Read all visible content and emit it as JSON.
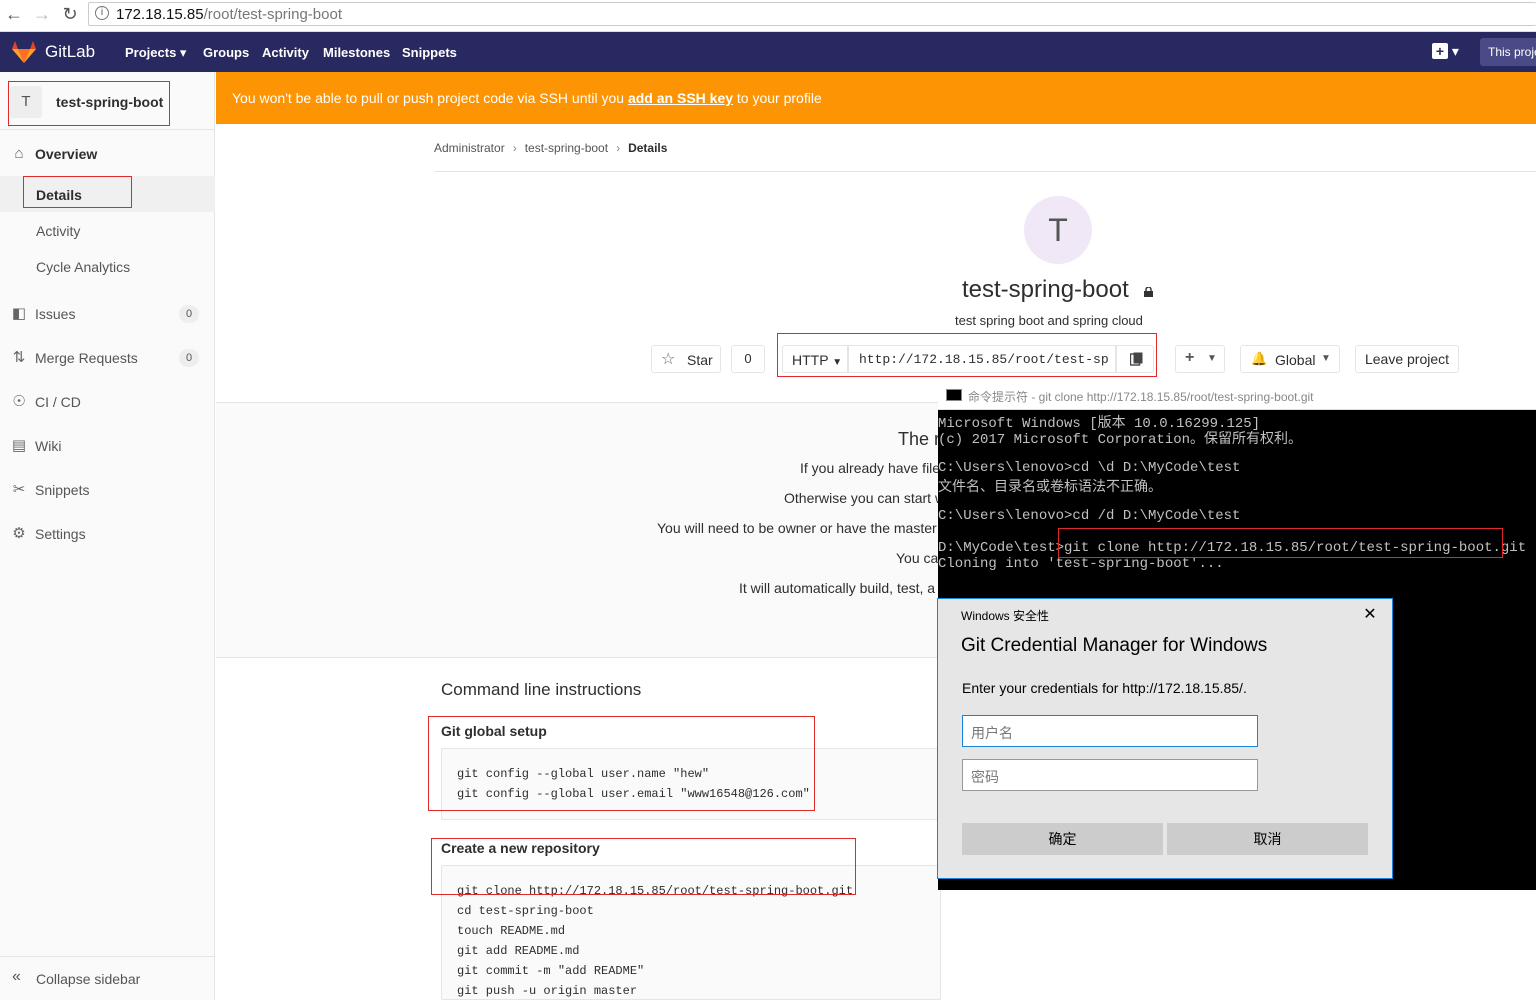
{
  "browser": {
    "url_host": "172.18.15.85",
    "url_path": "/root/test-spring-boot"
  },
  "topnav": {
    "brand": "GitLab",
    "links": [
      "Projects",
      "Groups",
      "Activity",
      "Milestones",
      "Snippets"
    ],
    "search_placeholder": "This proje",
    "header_color": "#292961"
  },
  "sidebar": {
    "project_avatar_letter": "T",
    "project_name": "test-spring-boot",
    "overview": "Overview",
    "sub_items": [
      "Details",
      "Activity",
      "Cycle Analytics"
    ],
    "issues": {
      "label": "Issues",
      "count": "0"
    },
    "merge_requests": {
      "label": "Merge Requests",
      "count": "0"
    },
    "ci_cd": "CI / CD",
    "wiki": "Wiki",
    "snippets": "Snippets",
    "settings": "Settings",
    "collapse": "Collapse sidebar"
  },
  "alert": {
    "text_before": "You won't be able to pull or push project code via SSH until you ",
    "link": "add an SSH key",
    "text_after": " to your profile",
    "color": "#fc9403"
  },
  "breadcrumb": [
    "Administrator",
    "test-spring-boot",
    "Details"
  ],
  "project": {
    "avatar_letter": "T",
    "title": "test-spring-boot",
    "description": "test spring boot and spring cloud",
    "star_label": "Star",
    "star_count": "0",
    "protocol": "HTTP",
    "clone_url": "http://172.18.15.85/root/test-sp",
    "notification": "Global",
    "leave": "Leave project"
  },
  "empty_repo": {
    "title": "The r",
    "lines": [
      "If you already have file",
      "Otherwise you can start w",
      "You will need to be owner or have the master",
      "You ca",
      "It will automatically build, test, a"
    ]
  },
  "cli": {
    "title": "Command line instructions",
    "global_setup_title": "Git global setup",
    "global_setup": [
      "git config --global user.name \"hew\"",
      "git config --global user.email \"www16548@126.com\""
    ],
    "new_repo_title": "Create a new repository",
    "new_repo": [
      "git clone http://172.18.15.85/root/test-spring-boot.git",
      "cd test-spring-boot",
      "touch README.md",
      "git add README.md",
      "git commit -m \"add README\"",
      "git push -u origin master"
    ]
  },
  "cmd": {
    "title": "命令提示符 - git  clone http://172.18.15.85/root/test-spring-boot.git",
    "lines": [
      "Microsoft Windows [版本 10.0.16299.125]",
      "(c) 2017 Microsoft Corporation。保留所有权利。",
      "",
      "C:\\Users\\lenovo>cd \\d D:\\MyCode\\test",
      "文件名、目录名或卷标语法不正确。",
      "",
      "C:\\Users\\lenovo>cd /d D:\\MyCode\\test",
      "",
      "D:\\MyCode\\test>git clone http://172.18.15.85/root/test-spring-boot.git",
      "Cloning into 'test-spring-boot'..."
    ]
  },
  "dialog": {
    "caption": "Windows 安全性",
    "heading": "Git Credential Manager for Windows",
    "prompt": "Enter your credentials for http://172.18.15.85/.",
    "username_placeholder": "用户名",
    "password_placeholder": "密码",
    "ok": "确定",
    "cancel": "取消"
  }
}
